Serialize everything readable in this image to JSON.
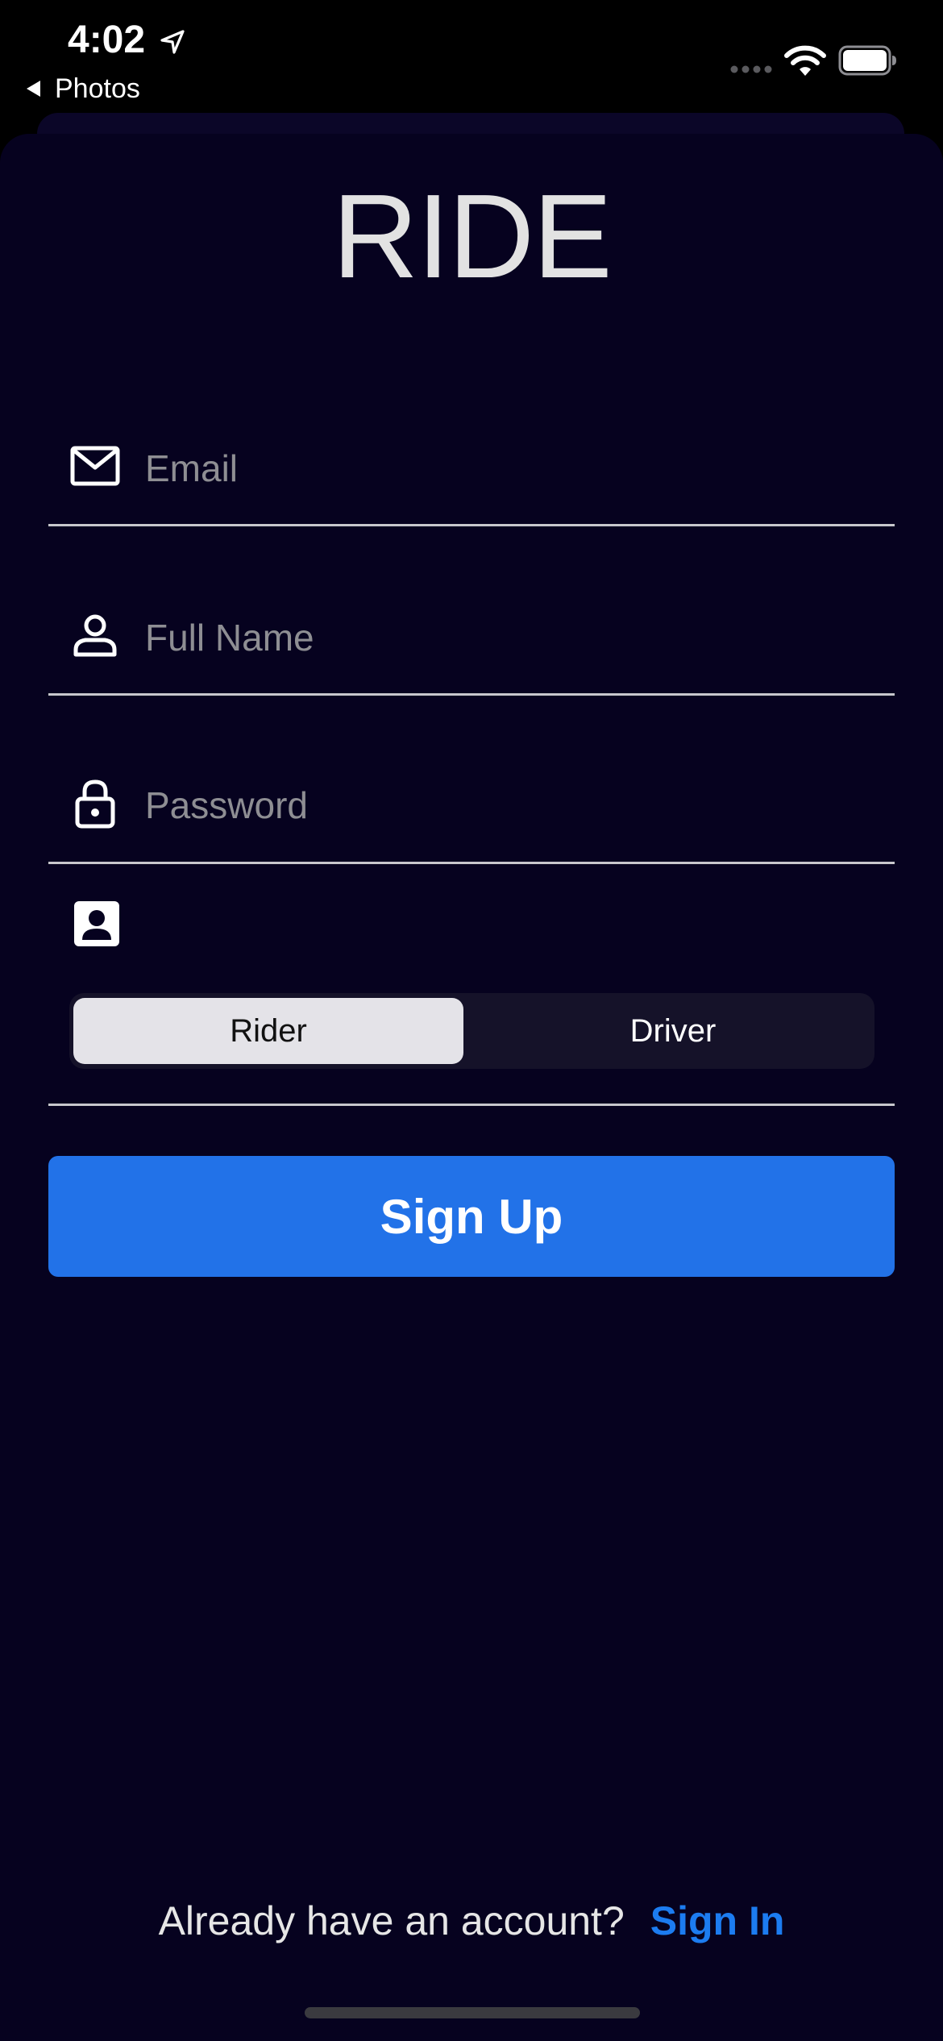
{
  "status_bar": {
    "time": "4:02",
    "back_label": "Photos"
  },
  "app": {
    "title": "RIDE"
  },
  "form": {
    "email_placeholder": "Email",
    "email_value": "",
    "fullname_placeholder": "Full Name",
    "fullname_value": "",
    "password_placeholder": "Password",
    "password_value": "",
    "account_type": {
      "options": [
        "Rider",
        "Driver"
      ],
      "selected": "Rider"
    },
    "signup_label": "Sign Up"
  },
  "footer": {
    "prompt": "Already have an account?",
    "link": "Sign In"
  },
  "colors": {
    "background": "#06021f",
    "accent": "#2272e8",
    "link": "#1c7cf0"
  },
  "icons": {
    "email": "envelope-icon",
    "fullname": "person-icon",
    "password": "lock-icon",
    "account_type": "person-card-icon"
  }
}
